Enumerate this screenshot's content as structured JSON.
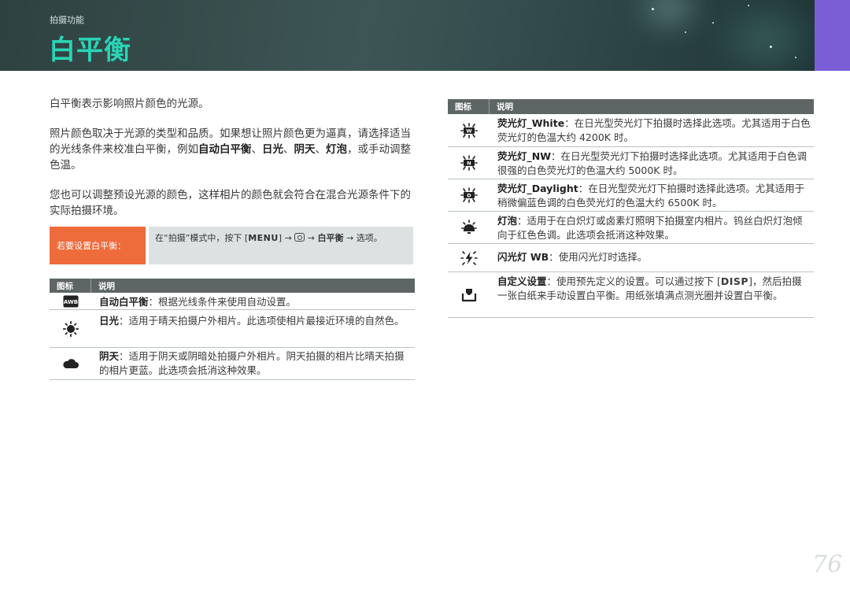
{
  "header": {
    "breadcrumb": "拍摄功能",
    "title": "白平衡"
  },
  "intro": {
    "p1": "白平衡表示影响照片颜色的光源。",
    "p2_a": "照片颜色取决于光源的类型和品质。如果想让照片颜色更为逼真，请选择适当的光线条件来校准白平衡，例如",
    "p2_b1": "自动白平衡",
    "p2_sep1": "、",
    "p2_b2": "日光",
    "p2_sep2": "、",
    "p2_b3": "阴天",
    "p2_sep3": "、",
    "p2_b4": "灯泡",
    "p2_c": "，或手动调整色温。",
    "p3": "您也可以调整预设光源的颜色，这样相片的颜色就会符合在混合光源条件下的实际拍摄环境。"
  },
  "tip": {
    "label": "若要设置白平衡：",
    "text_a": "在“拍摄”模式中，按下 [",
    "menu_key": "MENU",
    "text_b": "] → ",
    "arrow2": " → ",
    "bold_item": "白平衡",
    "text_c": " → 选项。"
  },
  "table_headers": {
    "icon": "图标",
    "desc": "说明"
  },
  "left_rows": [
    {
      "icon": "awb-icon",
      "name": "自动白平衡",
      "sep": "：",
      "desc": "根据光线条件来使用自动设置。"
    },
    {
      "icon": "sun-icon",
      "name": "日光",
      "sep": "：",
      "desc": "适用于晴天拍摄户外相片。此选项使相片最接近环境的自然色。"
    },
    {
      "icon": "cloud-icon",
      "name": "阴天",
      "sep": "：",
      "desc": "适用于阴天或阴暗处拍摄户外相片。阴天拍摄的相片比晴天拍摄的相片更蓝。此选项会抵消这种效果。"
    }
  ],
  "right_rows": [
    {
      "icon": "fluorescent-w-icon",
      "letter": "W",
      "name": "荧光灯_White",
      "sep": "：",
      "desc": "在日光型荧光灯下拍摄时选择此选项。尤其适用于白色荧光灯的色温大约 4200K 时。"
    },
    {
      "icon": "fluorescent-n-icon",
      "letter": "N",
      "name": "荧光灯_NW",
      "sep": "：",
      "desc": "在日光型荧光灯下拍摄时选择此选项。尤其适用于白色调很强的白色荧光灯的色温大约 5000K 时。"
    },
    {
      "icon": "fluorescent-d-icon",
      "letter": "D",
      "name": "荧光灯_Daylight",
      "sep": "：",
      "desc": "在日光型荧光灯下拍摄时选择此选项。尤其适用于稍微偏蓝色调的白色荧光灯的色温大约 6500K 时。"
    },
    {
      "icon": "bulb-icon",
      "name": "灯泡",
      "sep": "：",
      "desc": "适用于在白炽灯或卤素灯照明下拍摄室内相片。钨丝白炽灯泡倾向于红色色调。此选项会抵消这种效果。"
    },
    {
      "icon": "flash-wb-icon",
      "name": "闪光灯 WB",
      "sep": "：",
      "desc": "使用闪光灯时选择。"
    },
    {
      "icon": "custom-wb-icon",
      "name": "自定义设置",
      "sep": "：",
      "desc_a": "使用预先定义的设置。可以通过按下 [",
      "disp_key": "DISP",
      "desc_b": "]，然后拍摄一张白纸来手动设置白平衡。用纸张填满点测光圈并设置白平衡。"
    }
  ],
  "page_number": "76",
  "colors": {
    "title": "#2ad4b6",
    "tip_label": "#ee6b3b",
    "accent_tab": "#7b5ed6",
    "table_head": "#5d6565"
  }
}
